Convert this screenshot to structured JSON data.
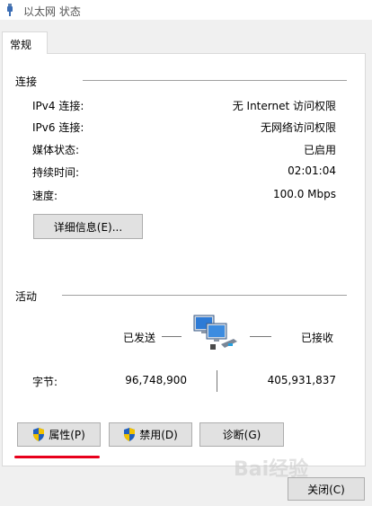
{
  "window": {
    "title": "以太网 状态",
    "icon": "network-cable-icon"
  },
  "tabs": [
    {
      "label": "常规",
      "selected": true
    }
  ],
  "connection": {
    "title": "连接",
    "rows": [
      {
        "label": "IPv4 连接:",
        "value": "无 Internet 访问权限"
      },
      {
        "label": "IPv6 连接:",
        "value": "无网络访问权限"
      },
      {
        "label": "媒体状态:",
        "value": "已启用"
      },
      {
        "label": "持续时间:",
        "value": "02:01:04"
      },
      {
        "label": "速度:",
        "value": "100.0 Mbps"
      }
    ],
    "details_button": "详细信息(E)..."
  },
  "activity": {
    "title": "活动",
    "sent_label": "已发送",
    "received_label": "已接收",
    "bytes_label": "字节:",
    "bytes_sent": "96,748,900",
    "bytes_received": "405,931,837"
  },
  "buttons": {
    "properties": "属性(P)",
    "disable": "禁用(D)",
    "diagnose": "诊断(G)",
    "close": "关闭(C)"
  },
  "watermark": "Bai经验",
  "colors": {
    "highlight": "#e8001c",
    "shield_blue": "#1f5fbf",
    "shield_yellow": "#f2c200"
  }
}
